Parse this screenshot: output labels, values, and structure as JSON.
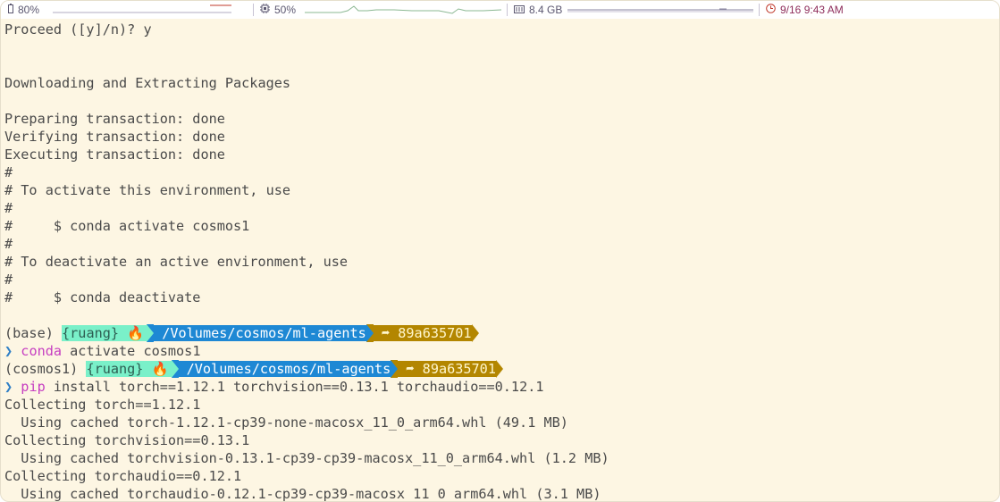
{
  "statusbar": {
    "battery": {
      "icon": "battery-icon",
      "value": "80%"
    },
    "cpu": {
      "icon": "cpu-icon",
      "value": "50%"
    },
    "memory": {
      "icon": "memory-icon",
      "value": "8.4 GB"
    },
    "clock": {
      "icon": "clock-icon",
      "value": "9/16 9:43 AM"
    }
  },
  "prompt": {
    "env_base": "(base) ",
    "env_new": "(cosmos1) ",
    "user": "{ruang} 🔥",
    "path": " /Volumes/cosmos/ml-agents",
    "git": " ➦ 89a635701",
    "arrow": "❯ "
  },
  "lines": [
    {
      "segments": [
        {
          "text": "Proceed ([y]/n)? y"
        }
      ]
    },
    {
      "segments": [
        {
          "text": ""
        }
      ]
    },
    {
      "segments": [
        {
          "text": ""
        }
      ]
    },
    {
      "segments": [
        {
          "text": "Downloading and Extracting Packages"
        }
      ]
    },
    {
      "segments": [
        {
          "text": ""
        }
      ]
    },
    {
      "segments": [
        {
          "text": "Preparing transaction: done"
        }
      ]
    },
    {
      "segments": [
        {
          "text": "Verifying transaction: done"
        }
      ]
    },
    {
      "segments": [
        {
          "text": "Executing transaction: done"
        }
      ]
    },
    {
      "segments": [
        {
          "text": "#"
        }
      ]
    },
    {
      "segments": [
        {
          "text": "# To activate this environment, use"
        }
      ]
    },
    {
      "segments": [
        {
          "text": "#"
        }
      ]
    },
    {
      "segments": [
        {
          "text": "#     $ conda activate cosmos1"
        }
      ]
    },
    {
      "segments": [
        {
          "text": "#"
        }
      ]
    },
    {
      "segments": [
        {
          "text": "# To deactivate an active environment, use"
        }
      ]
    },
    {
      "segments": [
        {
          "text": "#"
        }
      ]
    },
    {
      "segments": [
        {
          "text": "#     $ conda deactivate"
        }
      ]
    },
    {
      "segments": [
        {
          "text": ""
        }
      ]
    },
    {
      "prompt": "base"
    },
    {
      "segments": [
        {
          "text": "❯ ",
          "cls": "c-arrow"
        },
        {
          "text": "conda",
          "cls": "c-cmd"
        },
        {
          "text": " activate cosmos1"
        }
      ]
    },
    {
      "prompt": "new"
    },
    {
      "segments": [
        {
          "text": "❯ ",
          "cls": "c-arrow"
        },
        {
          "text": "pip",
          "cls": "c-cmd"
        },
        {
          "text": " install torch==1.12.1 torchvision==0.13.1 torchaudio==0.12.1"
        }
      ]
    },
    {
      "segments": [
        {
          "text": "Collecting torch==1.12.1"
        }
      ]
    },
    {
      "segments": [
        {
          "text": "  Using cached torch-1.12.1-cp39-none-macosx_11_0_arm64.whl (49.1 MB)"
        }
      ]
    },
    {
      "segments": [
        {
          "text": "Collecting torchvision==0.13.1"
        }
      ]
    },
    {
      "segments": [
        {
          "text": "  Using cached torchvision-0.13.1-cp39-cp39-macosx_11_0_arm64.whl (1.2 MB)"
        }
      ]
    },
    {
      "segments": [
        {
          "text": "Collecting torchaudio==0.12.1"
        }
      ]
    },
    {
      "segments": [
        {
          "text": "  Using cached torchaudio-0.12.1-cp39-cp39-macosx_11_0_arm64.whl (3.1 MB)"
        }
      ]
    }
  ]
}
